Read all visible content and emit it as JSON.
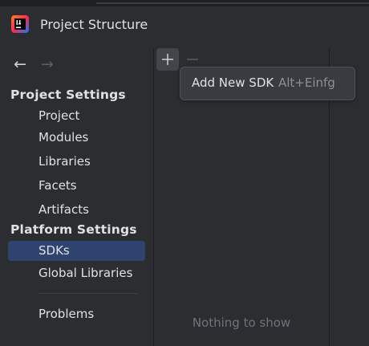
{
  "window": {
    "title": "Project Structure",
    "app_icon": "intellij-idea-logo"
  },
  "navigation": {
    "back_icon": "arrow-left-icon",
    "forward_icon": "arrow-right-icon",
    "back_glyph": "←",
    "forward_glyph": "→"
  },
  "sidebar": {
    "project_settings_header": "Project Settings",
    "project_settings_items": [
      {
        "label": "Project"
      },
      {
        "label": "Modules"
      },
      {
        "label": "Libraries"
      },
      {
        "label": "Facets"
      },
      {
        "label": "Artifacts"
      }
    ],
    "platform_settings_header": "Platform Settings",
    "platform_settings_items": [
      {
        "label": "SDKs",
        "selected": true
      },
      {
        "label": "Global Libraries"
      }
    ],
    "other_items": [
      {
        "label": "Problems"
      }
    ]
  },
  "middle_pane": {
    "toolbar": {
      "add_icon": "plus-icon",
      "remove_icon": "minus-icon"
    },
    "empty_text": "Nothing to show"
  },
  "tooltip": {
    "label": "Add New SDK",
    "shortcut": "Alt+Einfg"
  },
  "colors": {
    "background": "#2b2d30",
    "selection": "#2e436e",
    "text": "#dfe1e5",
    "muted_text": "#6f737a"
  }
}
